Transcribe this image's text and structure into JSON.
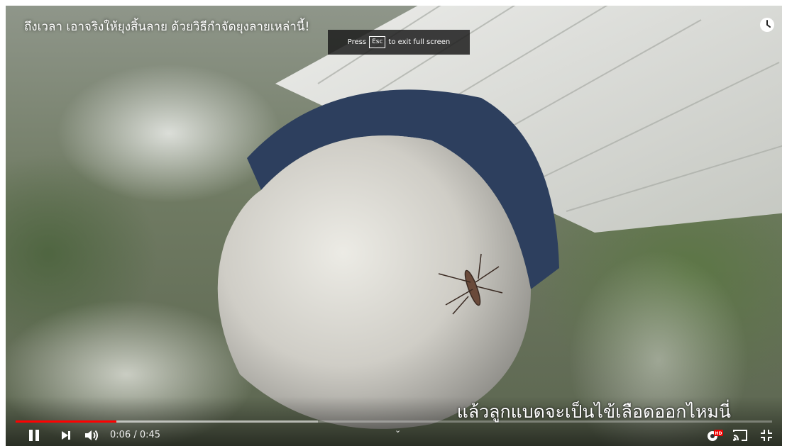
{
  "video": {
    "title": "ถึงเวลา เอาจริงให้ยุงสิ้นลาย ด้วยวิธีกำจัดยุงลายเหล่านี้!",
    "subtitle": "แล้วลูกแบดจะเป็นไข้เลือดออกไหมนี่"
  },
  "fullscreen_toast": {
    "press": "Press",
    "key": "Esc",
    "message": "to exit full screen"
  },
  "player": {
    "current_time": "0:06",
    "duration": "0:45",
    "time_display": "0:06 / 0:45",
    "played_fraction": 0.133,
    "buffered_fraction": 0.4,
    "quality_badge": "HD",
    "accent_color": "#ff0000"
  },
  "icons": [
    "clock-icon",
    "pause-icon",
    "next-icon",
    "volume-icon",
    "chevron-down-icon",
    "settings-icon",
    "cast-icon",
    "exit-fullscreen-icon"
  ]
}
